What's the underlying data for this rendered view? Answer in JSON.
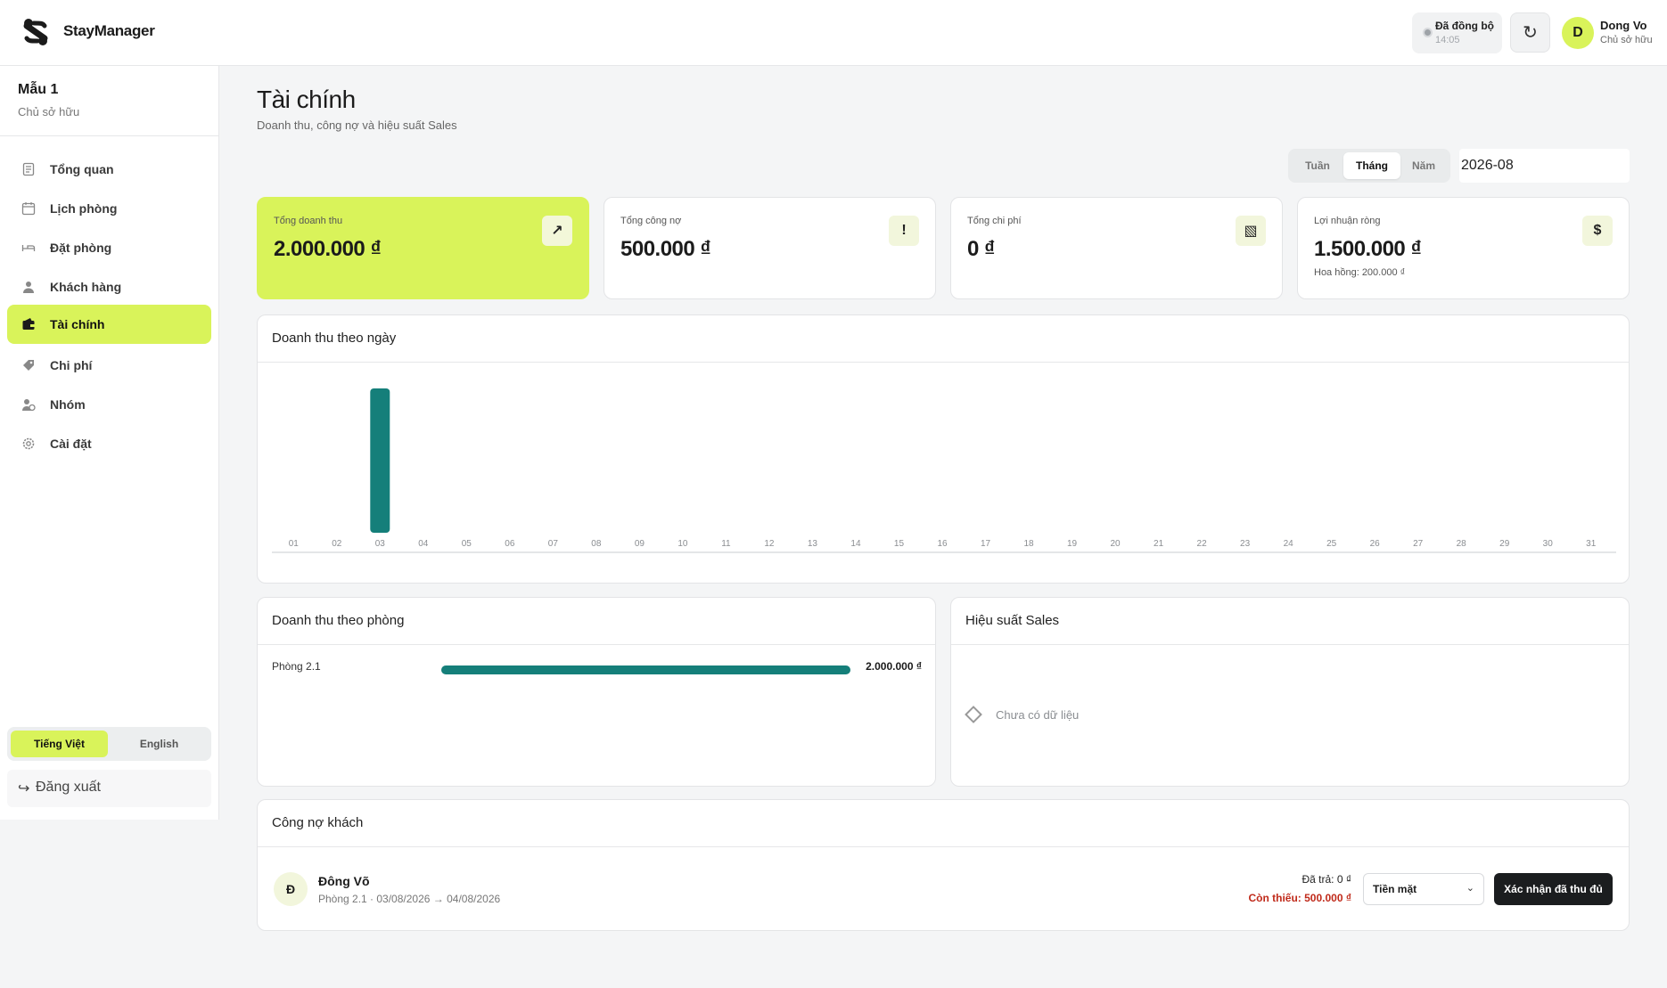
{
  "app": {
    "name": "StayManager",
    "accent": "#d9f35a",
    "chart_color": "#157f7a"
  },
  "header": {
    "sync_status": "Đã đồng bộ",
    "sync_time": "14:05",
    "user_name": "Dong Vo",
    "user_role": "Chủ sở hữu",
    "user_initial": "D"
  },
  "sidebar": {
    "workspace_name": "Mẫu 1",
    "workspace_role": "Chủ sở hữu",
    "items": [
      {
        "label": "Tổng quan",
        "icon": "document-icon"
      },
      {
        "label": "Lịch phòng",
        "icon": "calendar-icon"
      },
      {
        "label": "Đặt phòng",
        "icon": "bed-icon"
      },
      {
        "label": "Khách hàng",
        "icon": "user-icon"
      },
      {
        "label": "Tài chính",
        "icon": "wallet-icon",
        "active": true
      },
      {
        "label": "Chi phí",
        "icon": "tag-icon"
      },
      {
        "label": "Nhóm",
        "icon": "team-icon"
      },
      {
        "label": "Cài đặt",
        "icon": "gear-icon"
      }
    ],
    "languages": [
      "Tiếng Việt",
      "English"
    ],
    "active_language": "Tiếng Việt",
    "logout_label": "Đăng xuất"
  },
  "page": {
    "title": "Tài chính",
    "subtitle": "Doanh thu, công nợ và hiệu suất Sales",
    "period_options": [
      "Tuần",
      "Tháng",
      "Năm"
    ],
    "active_period": "Tháng",
    "period_value": "2026-08"
  },
  "stats": [
    {
      "label": "Tổng doanh thu",
      "value": "2.000.000 ₫",
      "icon": "trend-up-icon",
      "icon_glyph": "↗",
      "note": ""
    },
    {
      "label": "Tổng công nợ",
      "value": "500.000 ₫",
      "icon": "alert-icon",
      "icon_glyph": "!",
      "note": ""
    },
    {
      "label": "Tổng chi phí",
      "value": "0 ₫",
      "icon": "receipt-icon",
      "icon_glyph": "▧",
      "note": ""
    },
    {
      "label": "Lợi nhuận ròng",
      "value": "1.500.000 ₫",
      "icon": "dollar-icon",
      "icon_glyph": "$",
      "note": "Hoa hồng: 200.000 ₫"
    }
  ],
  "daily_revenue": {
    "title": "Doanh thu theo ngày"
  },
  "chart_data": {
    "type": "bar",
    "title": "Doanh thu theo ngày",
    "categories": [
      "01",
      "02",
      "03",
      "04",
      "05",
      "06",
      "07",
      "08",
      "09",
      "10",
      "11",
      "12",
      "13",
      "14",
      "15",
      "16",
      "17",
      "18",
      "19",
      "20",
      "21",
      "22",
      "23",
      "24",
      "25",
      "26",
      "27",
      "28",
      "29",
      "30",
      "31"
    ],
    "values": [
      0,
      0,
      2000000,
      0,
      0,
      0,
      0,
      0,
      0,
      0,
      0,
      0,
      0,
      0,
      0,
      0,
      0,
      0,
      0,
      0,
      0,
      0,
      0,
      0,
      0,
      0,
      0,
      0,
      0,
      0,
      0
    ],
    "ylim": [
      0,
      2000000
    ],
    "grid": false,
    "color": "#157f7a"
  },
  "room_revenue": {
    "title": "Doanh thu theo phòng",
    "rows": [
      {
        "room": "Phòng 2.1",
        "value": "2.000.000 ₫",
        "share": 1.0
      }
    ]
  },
  "sales_performance": {
    "title": "Hiệu suất Sales",
    "empty_text": "Chưa có dữ liệu"
  },
  "debts": {
    "title": "Công nợ khách",
    "rows": [
      {
        "initial": "Đ",
        "name": "Đông Võ",
        "meta": "Phòng 2.1 · 03/08/2026 → 04/08/2026",
        "paid": "Đã trả: 0 ₫",
        "owing": "Còn thiếu: 500.000 ₫",
        "method": "Tiền mặt",
        "confirm_label": "Xác nhận đã thu đủ"
      }
    ]
  }
}
